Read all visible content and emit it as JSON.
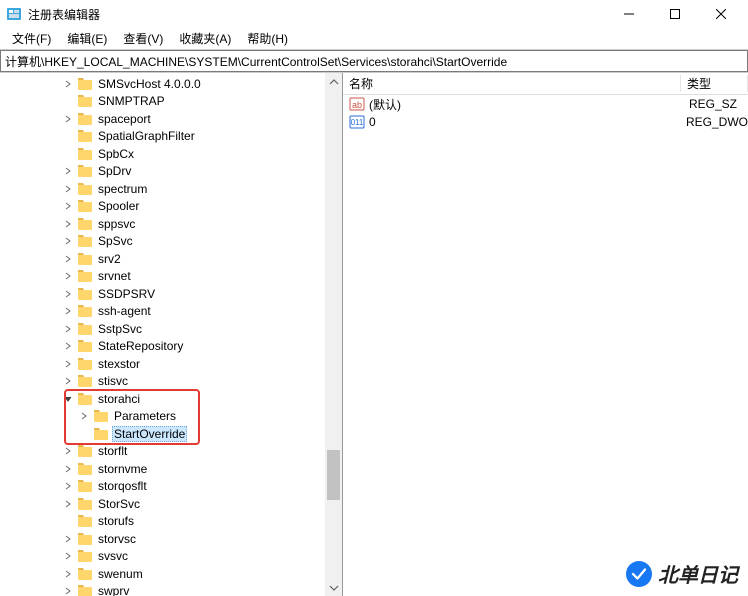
{
  "title": "注册表编辑器",
  "menu": {
    "file": "文件(F)",
    "edit": "编辑(E)",
    "view": "查看(V)",
    "favorites": "收藏夹(A)",
    "help": "帮助(H)"
  },
  "address": "计算机\\HKEY_LOCAL_MACHINE\\SYSTEM\\CurrentControlSet\\Services\\storahci\\StartOverride",
  "tree": {
    "items": [
      {
        "label": "SMSvcHost 4.0.0.0",
        "level": 1,
        "chev": "right"
      },
      {
        "label": "SNMPTRAP",
        "level": 1,
        "chev": "none"
      },
      {
        "label": "spaceport",
        "level": 1,
        "chev": "right"
      },
      {
        "label": "SpatialGraphFilter",
        "level": 1,
        "chev": "none"
      },
      {
        "label": "SpbCx",
        "level": 1,
        "chev": "none"
      },
      {
        "label": "SpDrv",
        "level": 1,
        "chev": "right"
      },
      {
        "label": "spectrum",
        "level": 1,
        "chev": "right"
      },
      {
        "label": "Spooler",
        "level": 1,
        "chev": "right"
      },
      {
        "label": "sppsvc",
        "level": 1,
        "chev": "right"
      },
      {
        "label": "SpSvc",
        "level": 1,
        "chev": "right"
      },
      {
        "label": "srv2",
        "level": 1,
        "chev": "right"
      },
      {
        "label": "srvnet",
        "level": 1,
        "chev": "right"
      },
      {
        "label": "SSDPSRV",
        "level": 1,
        "chev": "right"
      },
      {
        "label": "ssh-agent",
        "level": 1,
        "chev": "right"
      },
      {
        "label": "SstpSvc",
        "level": 1,
        "chev": "right"
      },
      {
        "label": "StateRepository",
        "level": 1,
        "chev": "right"
      },
      {
        "label": "stexstor",
        "level": 1,
        "chev": "right"
      },
      {
        "label": "stisvc",
        "level": 1,
        "chev": "right"
      },
      {
        "label": "storahci",
        "level": 1,
        "chev": "down"
      },
      {
        "label": "Parameters",
        "level": 2,
        "chev": "right"
      },
      {
        "label": "StartOverride",
        "level": 2,
        "chev": "none",
        "selected": true
      },
      {
        "label": "storflt",
        "level": 1,
        "chev": "right"
      },
      {
        "label": "stornvme",
        "level": 1,
        "chev": "right"
      },
      {
        "label": "storqosflt",
        "level": 1,
        "chev": "right"
      },
      {
        "label": "StorSvc",
        "level": 1,
        "chev": "right"
      },
      {
        "label": "storufs",
        "level": 1,
        "chev": "none"
      },
      {
        "label": "storvsc",
        "level": 1,
        "chev": "right"
      },
      {
        "label": "svsvc",
        "level": 1,
        "chev": "right"
      },
      {
        "label": "swenum",
        "level": 1,
        "chev": "right"
      },
      {
        "label": "swprv",
        "level": 1,
        "chev": "right"
      }
    ]
  },
  "list": {
    "col_name": "名称",
    "col_type": "类型",
    "rows": [
      {
        "icon": "string",
        "name": "(默认)",
        "type": "REG_SZ"
      },
      {
        "icon": "dword",
        "name": "0",
        "type": "REG_DWO"
      }
    ]
  },
  "watermark": "北单日记",
  "colors": {
    "highlight_border": "#e23b33",
    "selection_bg": "#cce8ff",
    "folder": "#ffd66b",
    "wm_blue": "#1877f2"
  }
}
